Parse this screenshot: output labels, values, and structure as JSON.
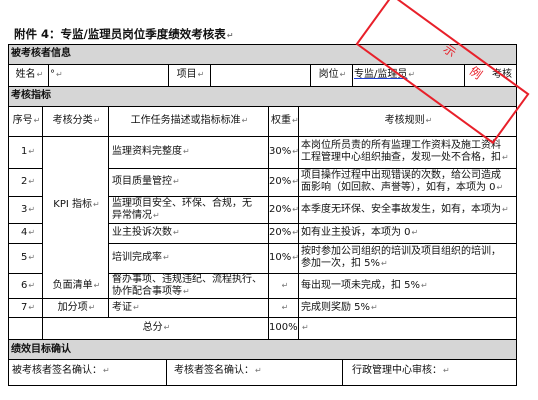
{
  "title": "附件 4：专监/监理员岗位季度绩效考核表",
  "para_mark": "↵",
  "stamp": {
    "char1": "示",
    "char2": "例"
  },
  "sections": {
    "examinee_info": "被考核者信息",
    "indicators": "考核指标",
    "confirmation": "绩效目标确认"
  },
  "info_row": {
    "name_label": "姓名",
    "name_value": "°",
    "project_label": "项目",
    "position_label": "岗位",
    "position_value": "专监/监理员",
    "examiner_label": "考核"
  },
  "table_headers": {
    "seq": "序号",
    "category": "考核分类",
    "task": "工作任务描述或指标标准",
    "weight": "权重",
    "rules": "考核规则"
  },
  "kpi_category": "KPI 指标",
  "rows": [
    {
      "seq": "1",
      "task": [
        "监理资料完整度"
      ],
      "weight": "30%",
      "rules": [
        "本岗位所员责的所有监理工作资料及施工资料",
        "工程管理中心组织抽查，发现一处不合格，扣"
      ]
    },
    {
      "seq": "2",
      "task": [
        "项目质量管控"
      ],
      "weight": "20%",
      "rules": [
        "项目操作过程中出现错误的次数，给公司造成",
        "面影响（如回款、声誉等），如有，本项为 0"
      ]
    },
    {
      "seq": "3",
      "task": [
        "监理项目安全、环保、合规，无",
        "异常情况"
      ],
      "weight": "20%",
      "rules": [
        "本季度无环保、安全事故发生，如有，本项为"
      ]
    },
    {
      "seq": "4",
      "task": [
        "业主投诉次数"
      ],
      "weight": "20%",
      "rules": [
        "如有业主投诉，本项为 0"
      ]
    },
    {
      "seq": "5",
      "task": [
        "培训完成率"
      ],
      "weight": "10%",
      "rules": [
        "按时参加公司组织的培训及项目组织的培训，",
        "参加一次，扣 5%"
      ]
    },
    {
      "seq": "6",
      "category": "负面清单",
      "task": [
        "督办事项、违规违纪、流程执行、",
        "协作配合事项等"
      ],
      "weight": "",
      "rules": [
        "每出现一项未完成，扣 5%"
      ]
    },
    {
      "seq": "7",
      "category": "加分项",
      "task": [
        "考证"
      ],
      "weight": "",
      "rules": [
        "完成则奖励 5%"
      ]
    }
  ],
  "total_row": {
    "label": "总分",
    "weight": "100%"
  },
  "signatures": {
    "examinee": "被考核者签名确认：",
    "examiner": "考核者签名确认：",
    "admin": "行政管理中心审核："
  }
}
